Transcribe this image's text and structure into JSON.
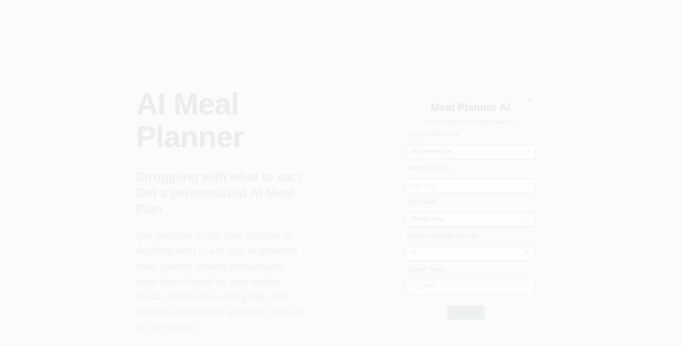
{
  "hero": {
    "title": "AI Meal Planner",
    "subtitle_plain": "Struggling with what to eat? Get a ",
    "subtitle_accent": "personalized AI Meal Plan",
    "description": "Say goodbye to the daily struggle of deciding what to eat. Our AI-powered meal planner creates personalized meal plans based on your dietary needs, preferences and goals. Just answer a few simple questions and let AI do the rest."
  },
  "form": {
    "title": "Meal Planner AI",
    "tagline": "Personalized meal plans with AI",
    "fields": [
      {
        "label": "Dietary Preference",
        "value": "No preference",
        "type": "select"
      },
      {
        "label": "Allergies (if any)",
        "value": "e.g. nuts",
        "type": "input"
      },
      {
        "label": "Meal Goal",
        "value": "Weight loss",
        "type": "select"
      },
      {
        "label": "Number of Meals per Day",
        "value": "3",
        "type": "select"
      },
      {
        "label": "Calorie Target",
        "value": "e.g. 2000",
        "type": "input"
      }
    ],
    "submit_label": "Generate"
  },
  "colors": {
    "accent": "#2a9d7f"
  }
}
